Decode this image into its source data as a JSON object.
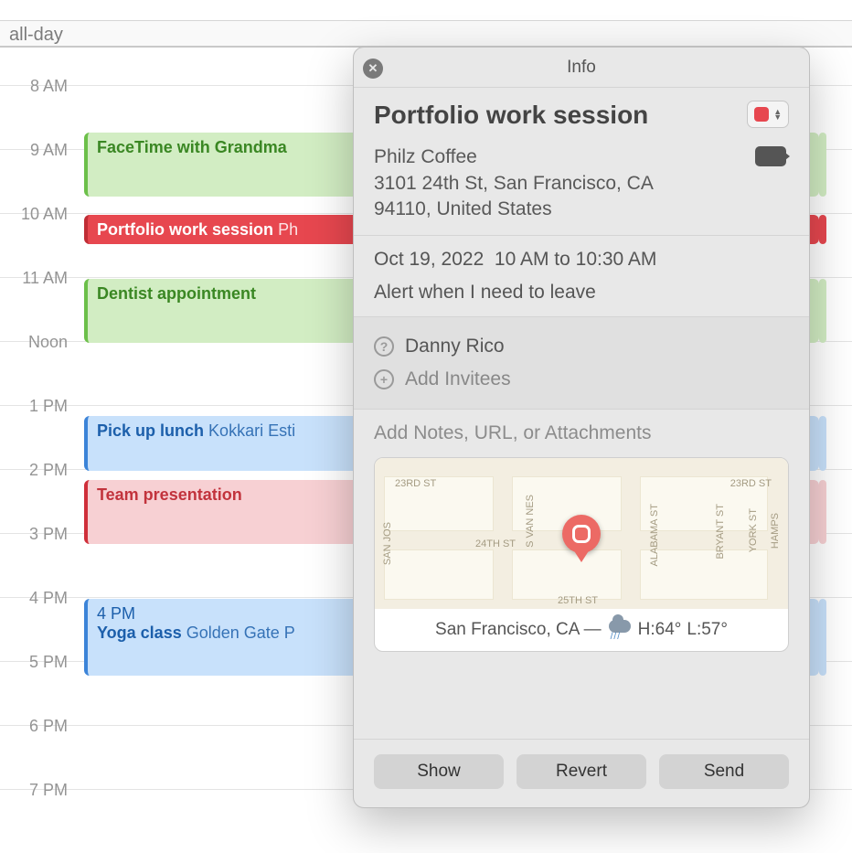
{
  "allday_label": "all-day",
  "hours": [
    "8 AM",
    "9 AM",
    "10 AM",
    "11 AM",
    "Noon",
    "1 PM",
    "2 PM",
    "3 PM",
    "4 PM",
    "5 PM",
    "6 PM",
    "7 PM"
  ],
  "events": {
    "facetime": {
      "title": "FaceTime with Grandma"
    },
    "portfolio": {
      "title": "Portfolio work session",
      "loc": "Ph"
    },
    "dentist": {
      "title": "Dentist appointment"
    },
    "lunch": {
      "title": "Pick up lunch",
      "loc": "Kokkari Esti"
    },
    "team": {
      "title": "Team presentation"
    },
    "yoga": {
      "time": "4 PM",
      "title": "Yoga class",
      "loc": "Golden Gate P"
    }
  },
  "popover": {
    "bar_title": "Info",
    "event_title": "Portfolio work session",
    "location_name": "Philz Coffee",
    "location_addr1": "3101 24th St, San Francisco, CA",
    "location_addr2": "94110, United States",
    "date": "Oct 19, 2022",
    "timerange": "10 AM to 10:30 AM",
    "alert": "Alert when I need to leave",
    "invitee_name": "Danny Rico",
    "add_invitees": "Add Invitees",
    "notes_placeholder": "Add Notes, URL, or Attachments",
    "weather_city": "San Francisco, CA —",
    "weather_hi": "H:64°",
    "weather_lo": "L:57°",
    "streets": {
      "s1": "23RD ST",
      "s1b": "23RD ST",
      "s2": "24TH ST",
      "s3": "25TH ST",
      "v1": "SAN JOS",
      "v2": "S VAN NES",
      "v3": "ALABAMA ST",
      "v4": "BRYANT ST",
      "v5": "YORK ST",
      "v6": "HAMPS"
    },
    "buttons": {
      "show": "Show",
      "revert": "Revert",
      "send": "Send"
    }
  }
}
